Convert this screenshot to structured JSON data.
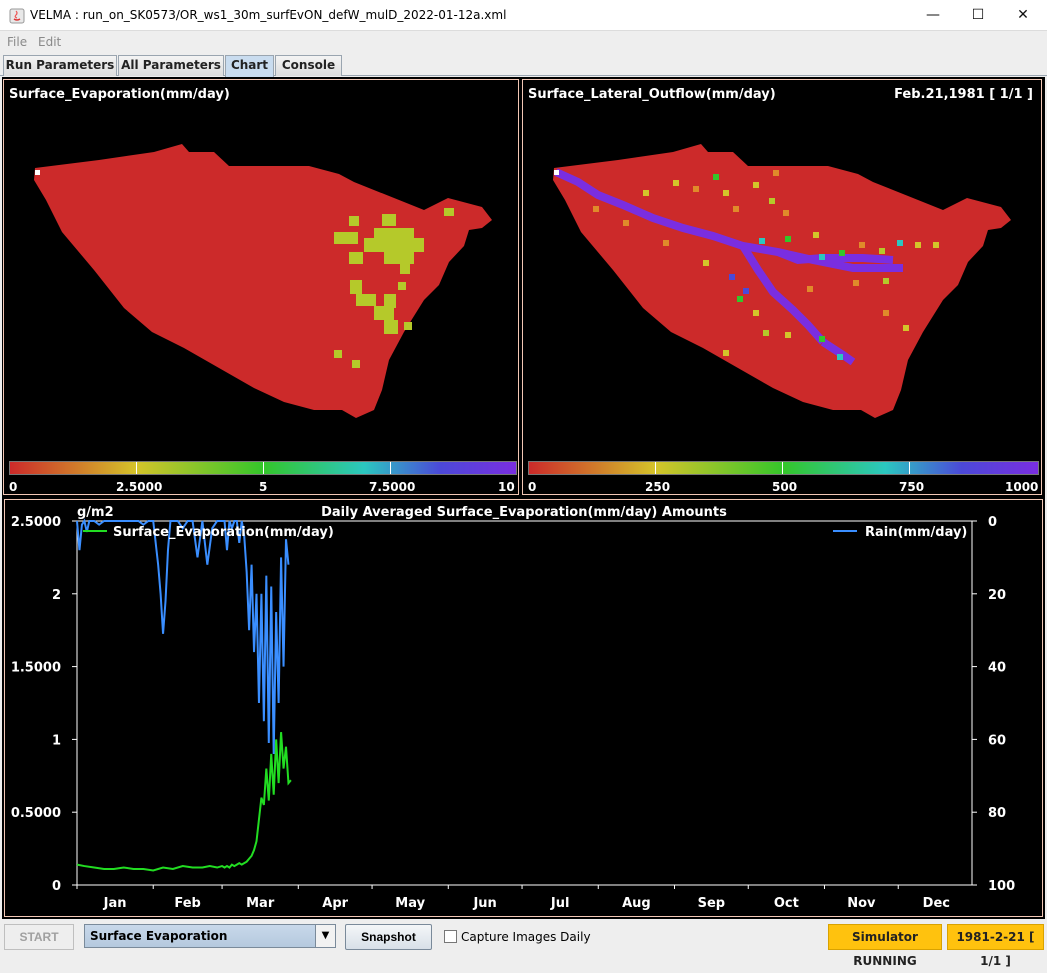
{
  "window": {
    "title": "VELMA : run_on_SK0573/OR_ws1_30m_surfEvON_defW_mulD_2022-01-12a.xml",
    "minimize": "—",
    "maximize": "☐",
    "close": "✕"
  },
  "menu": {
    "file": "File",
    "edit": "Edit"
  },
  "tabs": [
    {
      "label": "Run Parameters"
    },
    {
      "label": "All Parameters"
    },
    {
      "label": "Chart",
      "active": true
    },
    {
      "label": "Console"
    }
  ],
  "left_panel": {
    "title": "Surface_Evaporation(mm/day)",
    "colorbar_ticks": [
      "0",
      "2.5000",
      "5",
      "7.5000",
      "10"
    ],
    "colors": {
      "base": "#cc2a2a",
      "accent": "#afc72c"
    }
  },
  "right_panel": {
    "title": "Surface_Lateral_Outflow(mm/day)",
    "date": "Feb.21,1981 [ 1/1 ]",
    "colorbar_ticks": [
      "0",
      "250",
      "500",
      "750",
      "1000"
    ],
    "colors": {
      "base": "#cc2a2a",
      "stream": "#7a2ee0"
    }
  },
  "chart": {
    "title": "Daily Averaged Surface_Evaporation(mm/day) Amounts",
    "y_left_unit": "g/m2",
    "y_left_ticks": [
      "2.5000",
      "2",
      "1.5000",
      "1",
      "0.5000",
      "0"
    ],
    "y_right_ticks": [
      "0",
      "20",
      "40",
      "60",
      "80",
      "100"
    ],
    "months": [
      "Jan",
      "Feb",
      "Mar",
      "Apr",
      "May",
      "Jun",
      "Jul",
      "Aug",
      "Sep",
      "Oct",
      "Nov",
      "Dec"
    ],
    "legend_left": "Surface_Evaporation(mm/day)",
    "legend_right": "Rain(mm/day)"
  },
  "chart_data": {
    "type": "line",
    "title": "Daily Averaged Surface_Evaporation(mm/day) Amounts",
    "ylabel": "g/m2",
    "ylim": [
      0,
      2.5
    ],
    "y2lim": [
      100,
      0
    ],
    "xlim": [
      1,
      365
    ],
    "x_ticks": [
      "Jan",
      "Feb",
      "Mar",
      "Apr",
      "May",
      "Jun",
      "Jul",
      "Aug",
      "Sep",
      "Oct",
      "Nov",
      "Dec"
    ],
    "series": [
      {
        "name": "Surface_Evaporation(mm/day)",
        "axis": "left",
        "color": "#22dd22",
        "x": [
          1,
          4,
          8,
          12,
          16,
          20,
          24,
          28,
          32,
          36,
          40,
          44,
          48,
          52,
          55,
          58,
          60,
          61,
          62,
          63,
          64,
          65,
          66,
          67,
          68,
          69,
          70,
          71,
          72,
          73,
          74,
          75,
          76,
          77,
          78,
          79,
          80,
          81,
          82,
          83,
          84,
          85,
          86,
          87,
          88
        ],
        "values": [
          0.14,
          0.13,
          0.12,
          0.11,
          0.11,
          0.12,
          0.11,
          0.11,
          0.1,
          0.12,
          0.11,
          0.13,
          0.12,
          0.12,
          0.13,
          0.12,
          0.13,
          0.12,
          0.13,
          0.12,
          0.14,
          0.13,
          0.14,
          0.15,
          0.14,
          0.15,
          0.16,
          0.18,
          0.2,
          0.24,
          0.3,
          0.45,
          0.6,
          0.55,
          0.8,
          0.58,
          0.9,
          0.62,
          1.0,
          0.7,
          1.05,
          0.8,
          0.95,
          0.7,
          0.72
        ]
      },
      {
        "name": "Rain(mm/day)",
        "axis": "right",
        "color": "#3a8eff",
        "x": [
          1,
          2,
          3,
          4,
          5,
          6,
          8,
          10,
          12,
          14,
          16,
          18,
          20,
          22,
          24,
          26,
          28,
          30,
          32,
          34,
          35,
          36,
          37,
          38,
          39,
          40,
          42,
          44,
          46,
          48,
          50,
          52,
          54,
          56,
          58,
          60,
          61,
          62,
          63,
          64,
          65,
          66,
          67,
          68,
          69,
          70,
          71,
          72,
          73,
          74,
          75,
          76,
          77,
          78,
          79,
          80,
          81,
          82,
          83,
          84,
          85,
          86,
          87
        ],
        "values": [
          0,
          8,
          1,
          0,
          3,
          0,
          0,
          1,
          0,
          0,
          0,
          0,
          0,
          0,
          0,
          0,
          1,
          0,
          0,
          12,
          20,
          31,
          22,
          8,
          0,
          0,
          0,
          2,
          0,
          0,
          10,
          0,
          12,
          2,
          0,
          0,
          0,
          8,
          0,
          2,
          0,
          0,
          6,
          0,
          4,
          14,
          30,
          12,
          36,
          20,
          50,
          20,
          55,
          15,
          61,
          18,
          64,
          25,
          50,
          10,
          40,
          5,
          12
        ]
      }
    ],
    "legend": "top"
  },
  "statusbar": {
    "start": "START",
    "layer": "Surface Evaporation",
    "snapshot": "Snapshot",
    "capture": "Capture Images Daily",
    "sim_status": "Simulator RUNNING",
    "date": "1981-2-21 [ 1/1 ]"
  }
}
